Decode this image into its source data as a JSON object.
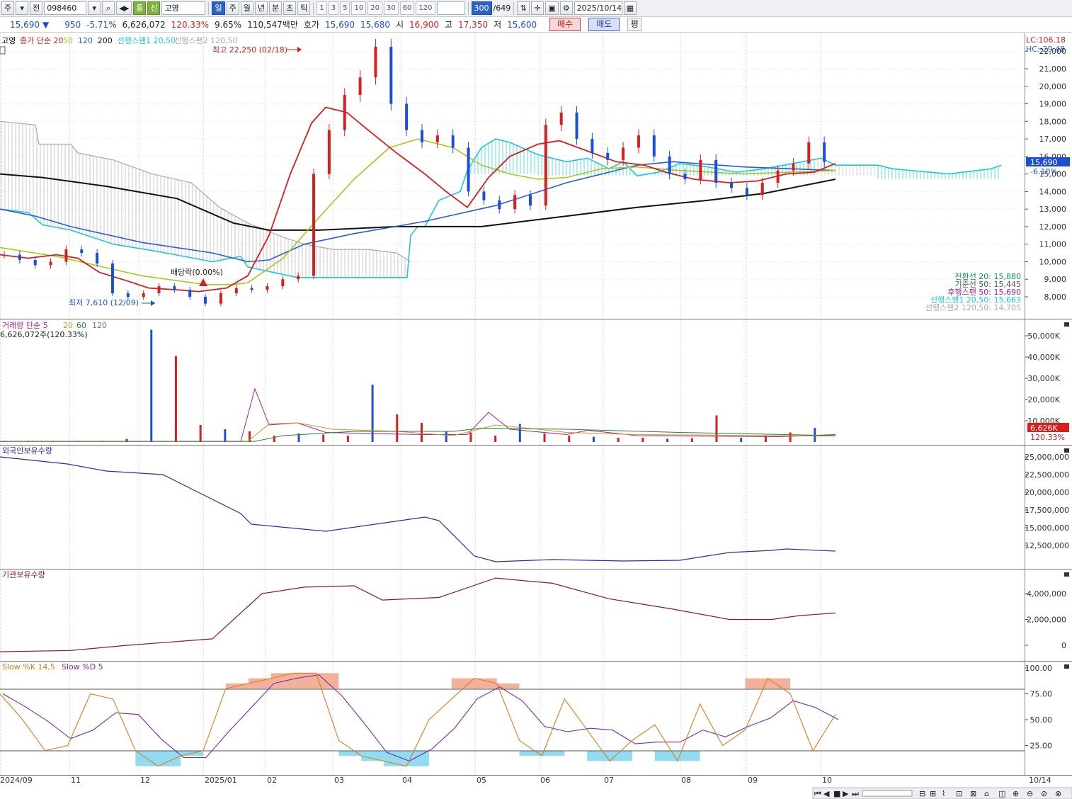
{
  "toolbar": {
    "market": "주",
    "prev": "전",
    "code": "098460",
    "mode": "통",
    "credit": "신",
    "name": "고영",
    "periods": [
      "일",
      "주",
      "월",
      "년",
      "분",
      "초",
      "틱"
    ],
    "numbers": [
      "1",
      "3",
      "5",
      "10",
      "20",
      "30",
      "60",
      "120"
    ],
    "count": "300",
    "total": "/649",
    "date": "2025/10/14"
  },
  "quote": {
    "price": "15,690",
    "arrow": "▼",
    "change": "950",
    "change_rate": "-5.71%",
    "volume": "6,626,072",
    "volume_ratio": "120.33%",
    "turnover": "9.65%",
    "amount": "110,547백만",
    "bid_label": "호가",
    "bid1": "15,690",
    "bid2": "15,680",
    "open_label": "시",
    "open": "16,900",
    "high_label": "고",
    "high": "17,350",
    "low_label": "저",
    "low": "15,600",
    "buy": "매수",
    "sell": "매도",
    "avg": "평"
  },
  "price_pane": {
    "title": "고영",
    "legend": [
      {
        "label": "종가 단순 20",
        "color": "#d81e1e"
      },
      {
        "label": "50",
        "color": "#a6c81a"
      },
      {
        "label": "120",
        "color": "#2b5bd8"
      },
      {
        "label": "200",
        "color": "#111111"
      },
      {
        "label": "선행스팬1 20,50",
        "color": "#1ec8d8"
      },
      {
        "label": "선행스팬2 120,50",
        "color": "#aaaaaa"
      }
    ],
    "lc": "LC:106.18",
    "hc": "HC:-29.48",
    "high_marker": "최고 22,250 (02/18)",
    "low_marker": "최저 7,610 (12/09)",
    "dividend": "배당락(0.00%)",
    "current_price_tag": "15,690",
    "current_rate_tag": "-6.10%",
    "y_ticks": [
      "22,000",
      "21,000",
      "20,000",
      "19,000",
      "18,000",
      "17,000",
      "16,000",
      "15,000",
      "14,000",
      "13,000",
      "12,000",
      "11,000",
      "10,000",
      "9,000",
      "8,000"
    ],
    "indicator_values": [
      {
        "label": "전환선 20: 15,880",
        "color": "#138a66"
      },
      {
        "label": "기준선 50: 15,445",
        "color": "#555555"
      },
      {
        "label": "후행스팬 50: 15,690",
        "color": "#a020a0"
      },
      {
        "label": "선행스팬1 20,50: 15,663",
        "color": "#1ec8d8"
      },
      {
        "label": "선행스팬2 120,50: 14,705",
        "color": "#aaaaaa"
      }
    ]
  },
  "volume_pane": {
    "legend_main": "거래량 단순 5",
    "legend_20": "20",
    "legend_60": "60",
    "legend_120": "120",
    "current": "6,626,072주(120.33%)",
    "tag": "6,626K",
    "tag_ratio": "120.33%",
    "y_ticks": [
      "50,000K",
      "40,000K",
      "30,000K",
      "20,000K",
      "10,000K"
    ]
  },
  "foreign_pane": {
    "title": "외국인보유수량",
    "y_ticks": [
      "25,000,000",
      "22,500,000",
      "20,000,000",
      "17,500,000",
      "15,000,000",
      "12,500,000"
    ]
  },
  "inst_pane": {
    "title": "기관보유수량",
    "y_ticks": [
      "4,000,000",
      "2,000,000",
      "0"
    ]
  },
  "stoch_pane": {
    "title_k": "Slow %K 14,5",
    "title_d": "Slow %D 5",
    "y_ticks": [
      "100.00",
      "75.00",
      "50.00",
      "25.00"
    ]
  },
  "x_axis": {
    "labels": [
      "2024/09",
      "11",
      "12",
      "2025/01",
      "02",
      "03",
      "04",
      "05",
      "06",
      "07",
      "08",
      "09",
      "10"
    ],
    "end_label": "10/14"
  },
  "chart_data": {
    "type": "candlestick",
    "symbol": "098460",
    "name": "고영",
    "price_ylim": [
      7500,
      22300
    ],
    "high": {
      "value": 22250,
      "date": "02/18"
    },
    "low": {
      "value": 7610,
      "date": "12/09"
    },
    "last": {
      "date": "2025/10/14",
      "close": 15690
    },
    "close_series_approx": [
      10400,
      10100,
      9800,
      10000,
      10700,
      10500,
      9900,
      8200,
      8000,
      8200,
      8600,
      8400,
      8000,
      7610,
      8200,
      8500,
      8400,
      8600,
      9000,
      9200,
      15000,
      17500,
      19500,
      20500,
      22250,
      19000,
      17500,
      16800,
      17200,
      16500,
      14000,
      13500,
      13000,
      13800,
      13200,
      17800,
      18500,
      17000,
      16200,
      15800,
      16500,
      17200,
      16000,
      15000,
      14700,
      15800,
      14500,
      14200,
      13800,
      14500,
      15200,
      15600,
      16800,
      15690
    ],
    "volume_k_approx": [
      200,
      150,
      300,
      200,
      500,
      1500,
      52800,
      40500,
      8000,
      6000,
      5000,
      3000,
      4000,
      3500,
      3000,
      27000,
      13000,
      9000,
      5000,
      4500,
      3000,
      8500,
      4000,
      3000,
      2500,
      2000,
      2000,
      1500,
      1800,
      12500,
      2000,
      3000,
      4500,
      6626
    ],
    "foreign_holdings_approx": [
      25000000,
      24000000,
      23000000,
      22500000,
      17000000,
      15500000,
      14500000,
      16500000,
      16000000,
      11000000,
      10200000,
      10500000,
      10300000,
      10400000,
      11500000,
      11800000,
      12000000,
      11700000
    ],
    "inst_holdings_approx": [
      -500000,
      -400000,
      0,
      500000,
      4000000,
      4500000,
      4600000,
      3500000,
      3700000,
      5200000,
      4800000,
      3600000,
      2800000,
      2000000,
      2000000,
      2300000,
      2500000
    ],
    "stoch_k_approx": [
      75,
      50,
      20,
      25,
      75,
      70,
      20,
      5,
      15,
      20,
      80,
      85,
      90,
      95,
      95,
      30,
      15,
      10,
      5,
      50,
      70,
      90,
      85,
      30,
      15,
      70,
      40,
      10,
      30,
      45,
      10,
      65,
      25,
      40,
      90,
      75,
      20,
      55
    ]
  }
}
